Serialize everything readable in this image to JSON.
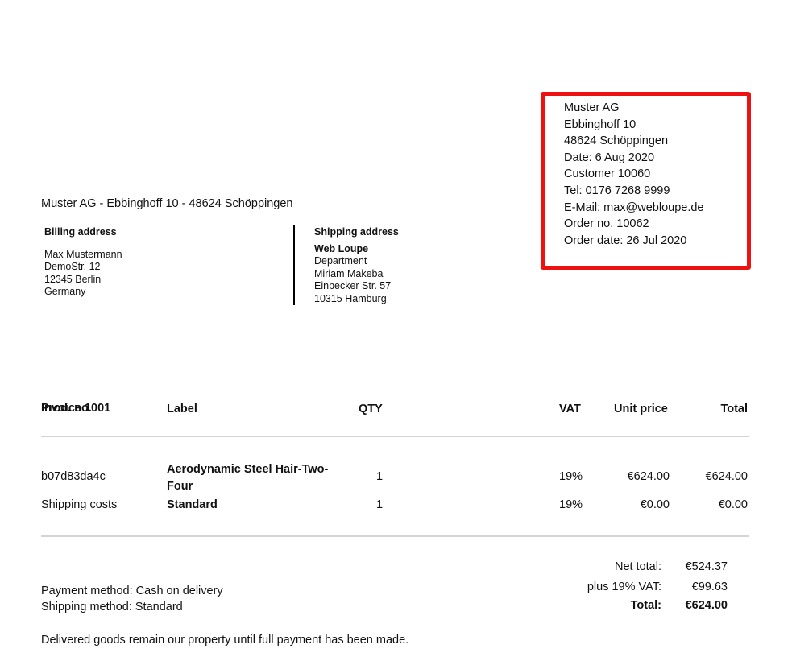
{
  "sender": {
    "company": "Muster AG",
    "street": "Ebbinghoff 10",
    "city": "48624 Schöppingen",
    "date": "Date: 6 Aug 2020",
    "customer": "Customer 10060",
    "tel": "Tel: 0176 7268 9999",
    "email": "E-Mail: max@webloupe.de",
    "order_no": "Order no. 10062",
    "order_date": "Order date: 26 Jul 2020"
  },
  "return_address": "Muster AG - Ebbinghoff 10 - 48624 Schöppingen",
  "billing": {
    "title": "Billing address",
    "lines": [
      "Max Mustermann",
      "DemoStr. 12",
      "12345 Berlin",
      "Germany"
    ]
  },
  "shipping": {
    "title": "Shipping address",
    "company": "Web Loupe",
    "lines": [
      "Department",
      "Miriam Makeba",
      "Einbecker Str. 57",
      "10315 Hamburg"
    ]
  },
  "table": {
    "headers": {
      "prod_no": "Prod. no.",
      "prod_no_overlap": "Invoice 1001",
      "label": "Label",
      "qty": "QTY",
      "vat": "VAT",
      "unit_price": "Unit price",
      "total": "Total"
    },
    "rows": [
      {
        "prod_no": "b07d83da4c",
        "label_line1": "Aerodynamic Steel Hair-Two-",
        "label_line2": "Four",
        "qty": "1",
        "vat": "19%",
        "unit_price": "€624.00",
        "total": "€624.00"
      },
      {
        "prod_no": "Shipping costs",
        "label_line1": "Standard",
        "qty": "1",
        "vat": "19%",
        "unit_price": "€0.00",
        "total": "€0.00"
      }
    ]
  },
  "totals": {
    "net_label": "Net total:",
    "net_value": "€524.37",
    "vat_label": "plus 19% VAT:",
    "vat_value": "€99.63",
    "total_label": "Total:",
    "total_value": "€624.00"
  },
  "footer": {
    "payment_method": "Payment method: Cash on delivery",
    "shipping_method": "Shipping method: Standard",
    "retention_note": "Delivered goods remain our property until full payment has been made."
  },
  "colors": {
    "highlight_border": "#ee1111",
    "rule": "#d4d4d4"
  }
}
